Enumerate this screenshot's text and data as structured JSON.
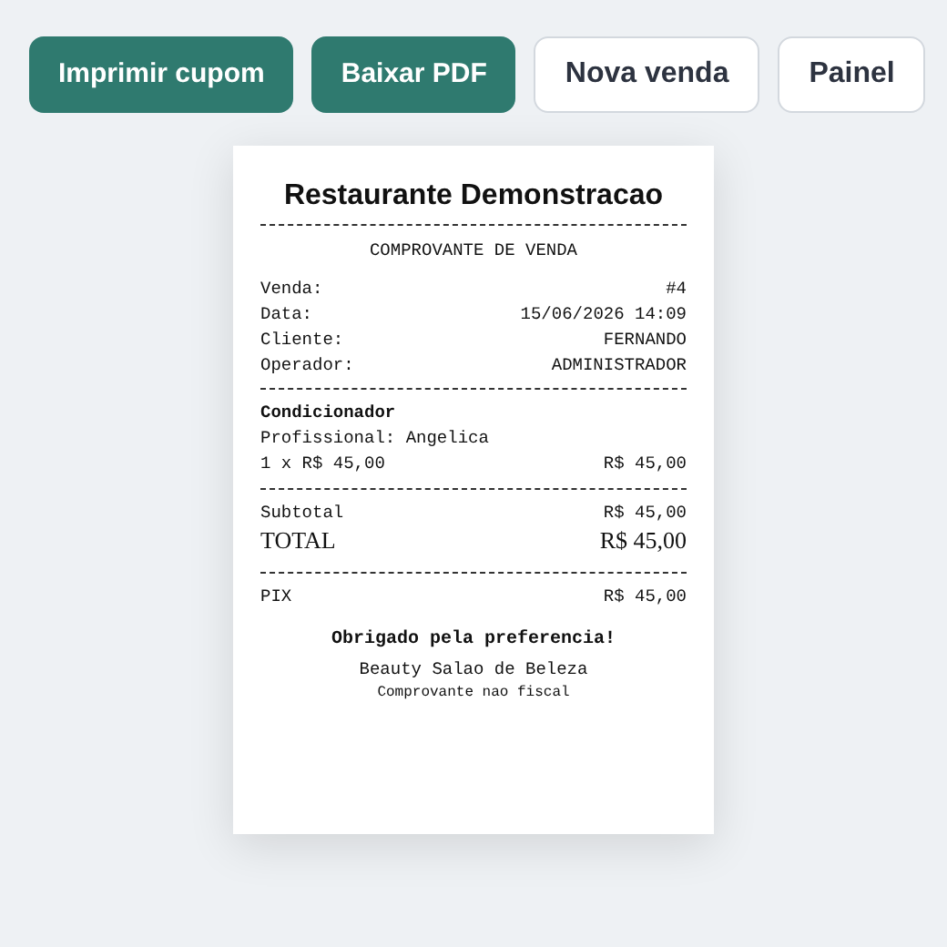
{
  "actions": [
    {
      "label": "Imprimir cupom",
      "kind": "primary"
    },
    {
      "label": "Baixar PDF",
      "kind": "primary"
    },
    {
      "label": "Nova venda",
      "kind": "secondary"
    },
    {
      "label": "Painel",
      "kind": "secondary"
    }
  ],
  "receipt": {
    "store_name": "Restaurante Demonstracao",
    "heading": "COMPROVANTE DE VENDA",
    "info": [
      {
        "label": "Venda:",
        "value": "#4"
      },
      {
        "label": "Data:",
        "value": "15/06/2026 14:09"
      },
      {
        "label": "Cliente:",
        "value": "FERNANDO"
      },
      {
        "label": "Operador:",
        "value": "ADMINISTRADOR"
      }
    ],
    "items": [
      {
        "name": "Condicionador",
        "professional": "Profissional: Angelica",
        "quantity_price": "1 x R$ 45,00",
        "amount": "R$ 45,00"
      }
    ],
    "subtotal": {
      "label": "Subtotal",
      "value": "R$ 45,00"
    },
    "total": {
      "label": "TOTAL",
      "value": "R$ 45,00"
    },
    "payments": [
      {
        "label": "PIX",
        "value": "R$ 45,00"
      }
    ],
    "thanks": "Obrigado pela preferencia!",
    "business": "Beauty Salao de Beleza",
    "note": "Comprovante nao fiscal"
  }
}
